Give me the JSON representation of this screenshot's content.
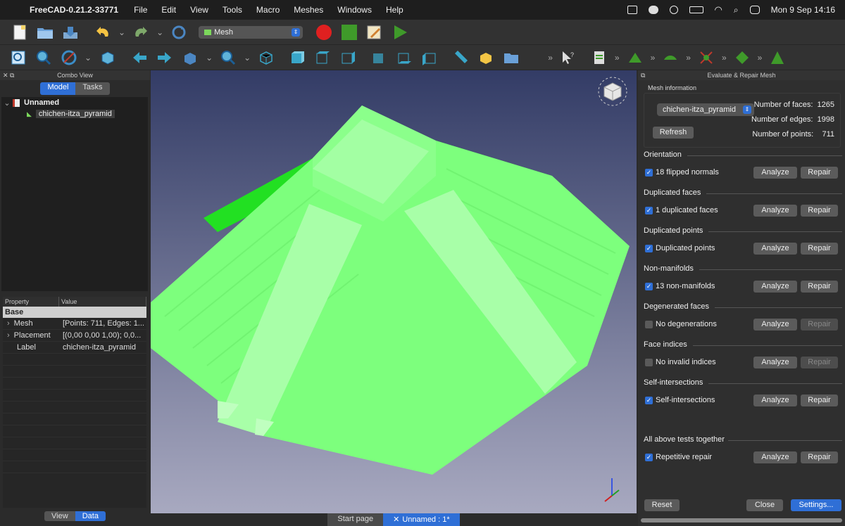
{
  "menubar": {
    "app_name": "FreeCAD-0.21.2-33771",
    "menus": [
      "File",
      "Edit",
      "View",
      "Tools",
      "Macro",
      "Meshes",
      "Windows",
      "Help"
    ],
    "clock": "Mon 9 Sep  14:16"
  },
  "toolbar": {
    "workbench": "Mesh"
  },
  "combo_view": {
    "title": "Combo View",
    "tabs": [
      "Model",
      "Tasks"
    ],
    "tree": {
      "document": "Unnamed",
      "object": "chichen-itza_pyramid"
    },
    "properties": {
      "headers": [
        "Property",
        "Value"
      ],
      "group": "Base",
      "rows": [
        {
          "key": "Mesh",
          "value": "[Points: 711, Edges: 1..."
        },
        {
          "key": "Placement",
          "value": "[(0,00 0,00 1,00); 0,0..."
        },
        {
          "key": "Label",
          "value": "chichen-itza_pyramid"
        }
      ]
    },
    "bottom_tabs": [
      "View",
      "Data"
    ]
  },
  "doc_tabs": [
    "Start page",
    "Unnamed : 1*"
  ],
  "repair_panel": {
    "title": "Evaluate & Repair Mesh",
    "mesh_info_label": "Mesh information",
    "mesh_select": "chichen-itza_pyramid",
    "refresh": "Refresh",
    "stats": {
      "faces_label": "Number of faces:",
      "faces": "1265",
      "edges_label": "Number of edges:",
      "edges": "1998",
      "points_label": "Number of points:",
      "points": "711"
    },
    "analyze": "Analyze",
    "repair": "Repair",
    "sections": [
      {
        "title": "Orientation",
        "check": "18 flipped normals",
        "checked": true,
        "repair_enabled": true
      },
      {
        "title": "Duplicated faces",
        "check": "1 duplicated faces",
        "checked": true,
        "repair_enabled": true
      },
      {
        "title": "Duplicated points",
        "check": "Duplicated points",
        "checked": true,
        "repair_enabled": true
      },
      {
        "title": "Non-manifolds",
        "check": "13 non-manifolds",
        "checked": true,
        "repair_enabled": true
      },
      {
        "title": "Degenerated faces",
        "check": "No degenerations",
        "checked": false,
        "repair_enabled": false
      },
      {
        "title": "Face indices",
        "check": "No invalid indices",
        "checked": false,
        "repair_enabled": false
      },
      {
        "title": "Self-intersections",
        "check": "Self-intersections",
        "checked": true,
        "repair_enabled": true
      }
    ],
    "all_tests": {
      "title": "All above tests together",
      "check": "Repetitive repair"
    },
    "reset": "Reset",
    "close": "Close",
    "settings": "Settings..."
  },
  "colors": {
    "accent": "#2f6fd6",
    "mesh_green": "#7dff7d"
  }
}
